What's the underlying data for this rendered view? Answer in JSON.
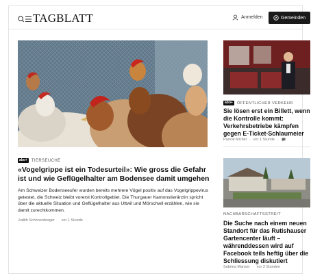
{
  "header": {
    "logo": "TAGBLATT",
    "login_label": "Anmelden",
    "join_label": "Gemeinden"
  },
  "main_article": {
    "kicker": "TIERSEUCHE",
    "badge": "abo+",
    "title": "«Vogelgrippe ist ein Todesurteil»: Wie gross die Gefahr ist und wie Geflügelhalter am Bodensee damit umgehen",
    "lead": "Am Schweizer Bodenseeufer wurden bereits mehrere Vögel positiv auf das Vogelgrippevirus getestet, die Schweiz bleibt vorerst Kontrollgebiet. Die Thurgauer Kantonstierärztin spricht über die aktuelle Situation und Geflügelhalter aus Uttwil und Mörschwil erzählen, wie sie damit zurechtkommen.",
    "author": "Judith Schönenberger",
    "time": "vor 1 Stunde"
  },
  "side_article_1": {
    "badge": "abo+",
    "kicker": "ÖFFENTLICHER VERKEHR",
    "title": "Sie lösen erst ein Billett, wenn die Kontrolle kommt: Verkehrsbetriebe kämpfen gegen E-Ticket-Schlaumeier",
    "author": "Pascal Michel",
    "time": "vor 1 Stunde"
  },
  "side_article_2": {
    "kicker": "NACHBARSCHAFTSSTREIT",
    "title": "Die Suche nach einem neuen Standort für das Rutishauser Gartencenter läuft – währenddessen wird auf Facebook teils heftig über die Schliessung diskutiert",
    "author": "Sabrina Manser",
    "time": "vor 2 Stunden"
  },
  "icons": {
    "search": "search-icon",
    "menu": "menu-icon",
    "user": "user-icon",
    "compass": "compass-icon",
    "comment": "comment-icon"
  },
  "colors": {
    "accent_dark": "#1a1a1a",
    "text": "#111111",
    "meta": "#777777"
  }
}
